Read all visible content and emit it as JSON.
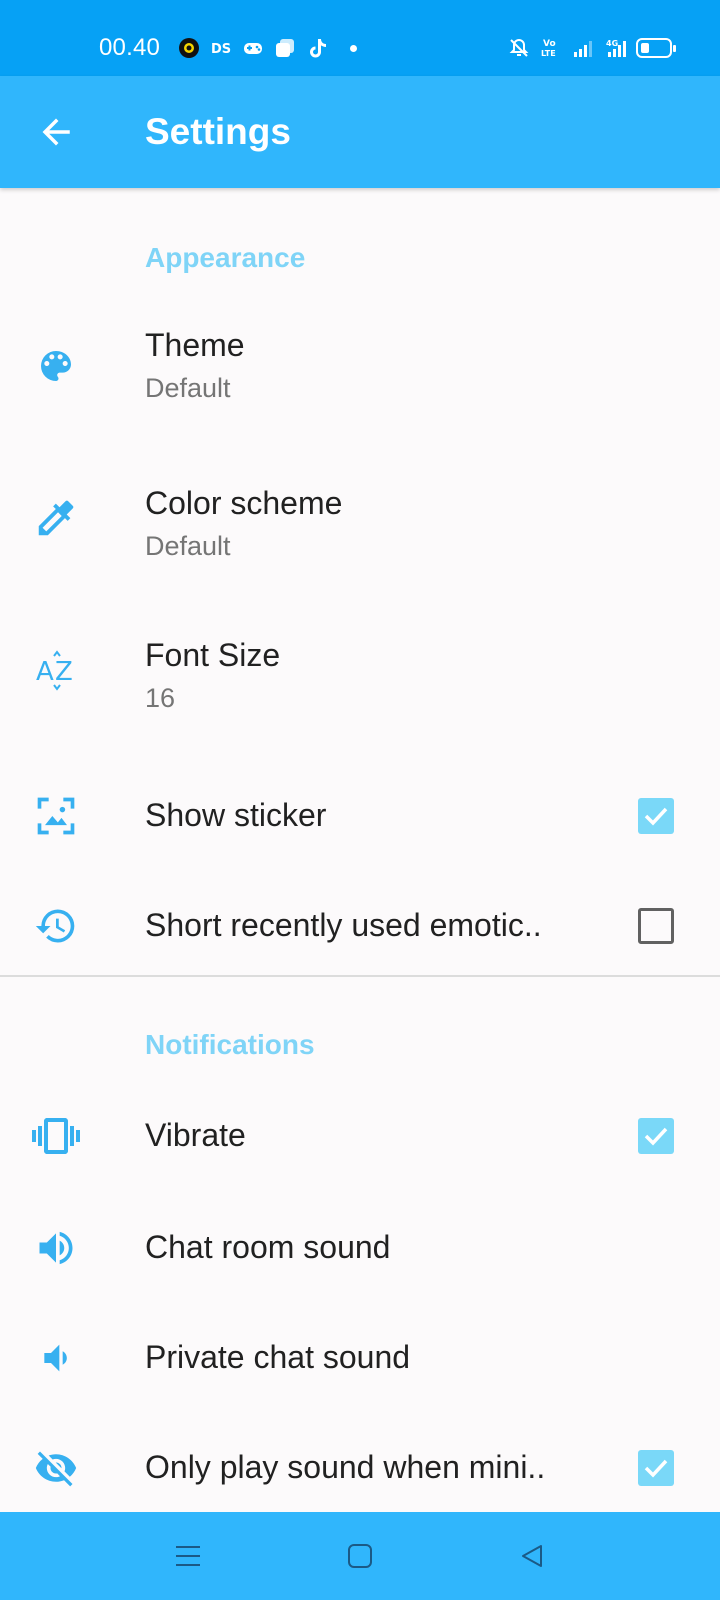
{
  "status_bar": {
    "time": "00.40",
    "left_icons": [
      "app-circle-icon",
      "ds-app-icon",
      "gamepad-icon",
      "gallery-icon",
      "tiktok-icon",
      "dot-icon"
    ],
    "right_icons": [
      "mute-bell-icon",
      "volte-icon",
      "signal-icon",
      "signal-4g-icon",
      "battery-icon"
    ],
    "volte_label": "Vo LTE",
    "network_label": "4G"
  },
  "app_bar": {
    "title": "Settings",
    "back_icon": "arrow-back-icon"
  },
  "sections": {
    "appearance": {
      "header": "Appearance",
      "theme": {
        "title": "Theme",
        "value": "Default",
        "icon": "palette-icon"
      },
      "color_scheme": {
        "title": "Color scheme",
        "value": "Default",
        "icon": "eyedropper-icon"
      },
      "font_size": {
        "title": "Font Size",
        "value": "16",
        "icon": "font-size-icon"
      },
      "show_sticker": {
        "title": "Show sticker",
        "checked": true,
        "icon": "image-frame-icon"
      },
      "short_recent": {
        "title": "Short recently used emotic..",
        "checked": false,
        "icon": "history-icon"
      }
    },
    "notifications": {
      "header": "Notifications",
      "vibrate": {
        "title": "Vibrate",
        "checked": true,
        "icon": "vibrate-icon"
      },
      "chat_room_sound": {
        "title": "Chat room sound",
        "icon": "volume-up-icon"
      },
      "private_chat_sound": {
        "title": "Private chat sound",
        "icon": "volume-down-icon"
      },
      "only_play_sound": {
        "title": "Only play sound when mini..",
        "checked": true,
        "icon": "eye-off-icon"
      }
    }
  },
  "nav_bar": {
    "buttons": [
      "menu-icon",
      "home-square-icon",
      "back-triangle-icon"
    ]
  },
  "colors": {
    "status_bar": "#06a1f5",
    "app_bar": "#30b6fc",
    "accent_icon": "#37b0f0",
    "section_header": "#7fd4f7",
    "checkbox_checked": "#7ad8f8"
  }
}
